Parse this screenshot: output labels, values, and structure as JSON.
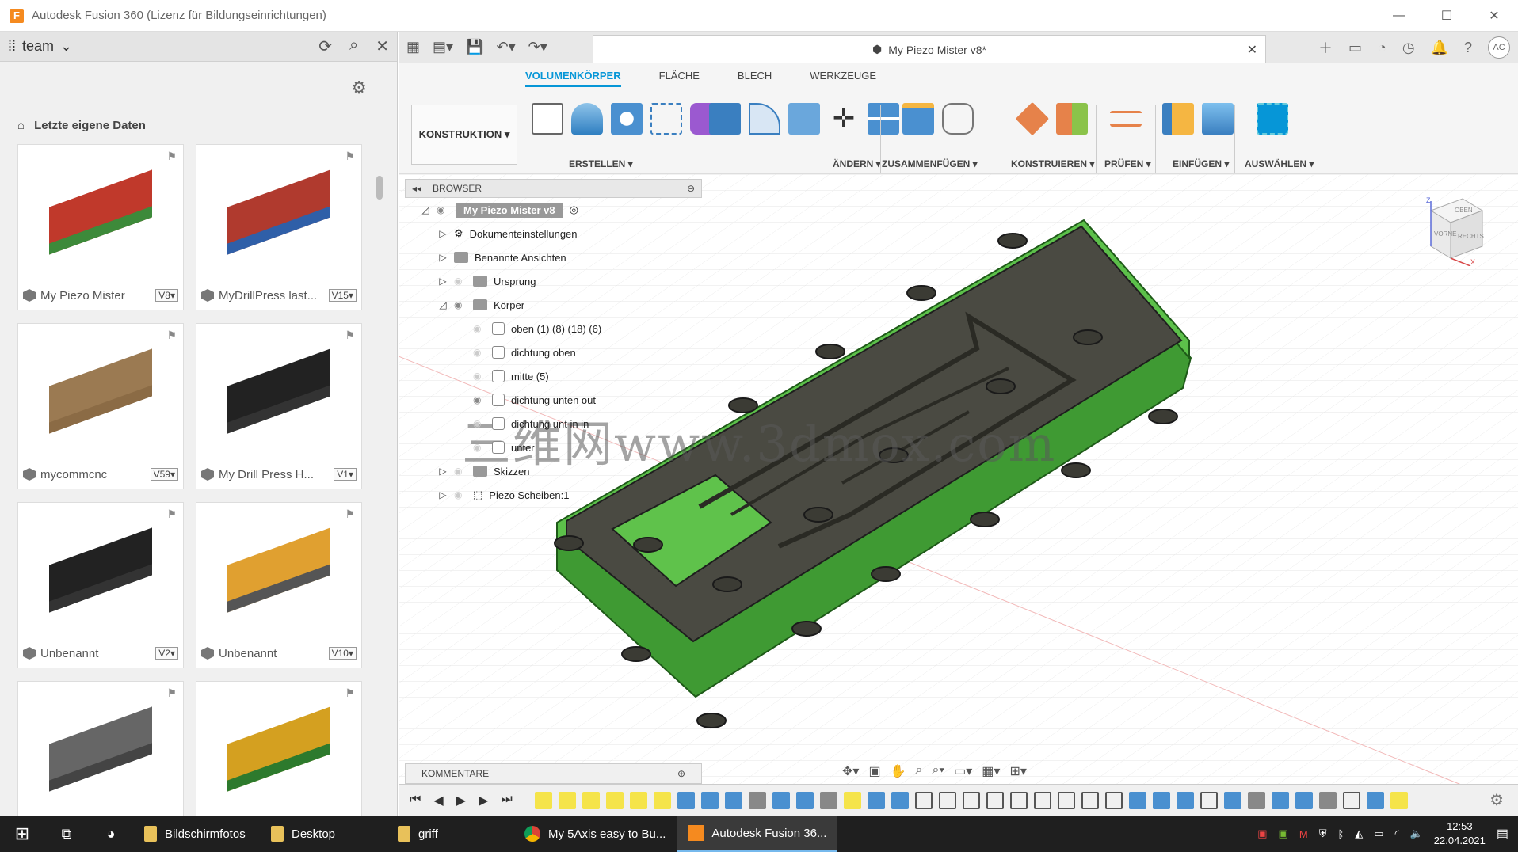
{
  "window": {
    "title": "Autodesk Fusion 360 (Lizenz für Bildungseinrichtungen)",
    "logo": "F",
    "minimize": "—",
    "maximize": "☐",
    "close": "✕"
  },
  "left_panel": {
    "team_label": "team",
    "breadcrumb": "Letzte eigene Daten",
    "cards": [
      {
        "name": "My Piezo Mister",
        "version": "V8▾",
        "thumb_color": "#c0392b",
        "base_color": "#3d8a3a"
      },
      {
        "name": "MyDrillPress last...",
        "version": "V15▾",
        "thumb_color": "#b03a2e",
        "base_color": "#2f5fa8"
      },
      {
        "name": "mycommcnc",
        "version": "V59▾",
        "thumb_color": "#9b7a52",
        "base_color": "#8b6b45"
      },
      {
        "name": "My Drill Press H...",
        "version": "V1▾",
        "thumb_color": "#222222",
        "base_color": "#333333"
      },
      {
        "name": "Unbenannt",
        "version": "V2▾",
        "thumb_color": "#222222",
        "base_color": "#333333"
      },
      {
        "name": "Unbenannt",
        "version": "V10▾",
        "thumb_color": "#e0a030",
        "base_color": "#555555"
      },
      {
        "name": "",
        "version": "",
        "thumb_color": "#666666",
        "base_color": "#444444"
      },
      {
        "name": "",
        "version": "",
        "thumb_color": "#d4a020",
        "base_color": "#2d7a2d"
      }
    ]
  },
  "document": {
    "tab_title": "My Piezo Mister v8*",
    "avatar": "AC"
  },
  "ribbon": {
    "konstruktion": "KONSTRUKTION ▾",
    "tabs": [
      "VOLUMENKÖRPER",
      "FLÄCHE",
      "BLECH",
      "WERKZEUGE"
    ],
    "groups": [
      "ERSTELLEN ▾",
      "ÄNDERN ▾",
      "ZUSAMMENFÜGEN ▾",
      "KONSTRUIEREN ▾",
      "PRÜFEN ▾",
      "EINFÜGEN ▾",
      "AUSWÄHLEN ▾"
    ]
  },
  "browser": {
    "header": "BROWSER",
    "root": "My Piezo Mister v8",
    "items": [
      {
        "label": "Dokumenteinstellungen"
      },
      {
        "label": "Benannte Ansichten"
      },
      {
        "label": "Ursprung"
      },
      {
        "label": "Körper"
      },
      {
        "label": "oben (1) (8) (18) (6)"
      },
      {
        "label": "dichtung oben"
      },
      {
        "label": "mitte (5)"
      },
      {
        "label": "dichtung unten out"
      },
      {
        "label": "dichtung unt in in"
      },
      {
        "label": "unter"
      },
      {
        "label": "Skizzen"
      },
      {
        "label": "Piezo Scheiben:1"
      }
    ]
  },
  "kommentare": "KOMMENTARE",
  "viewcube": {
    "top": "OBEN",
    "front": "VORNE",
    "right": "RECHTS",
    "axis_z": "Z",
    "axis_x": "X"
  },
  "watermark": "三维网www.3dmox.com",
  "colors": {
    "accent": "#0696d7",
    "part_green": "#4caf3e",
    "part_dark": "#4a4a42"
  },
  "taskbar": {
    "items": [
      "Bildschirmfotos",
      "Desktop",
      "griff",
      "My 5Axis easy to Bu...",
      "Autodesk Fusion 36..."
    ],
    "time": "12:53",
    "date": "22.04.2021"
  }
}
